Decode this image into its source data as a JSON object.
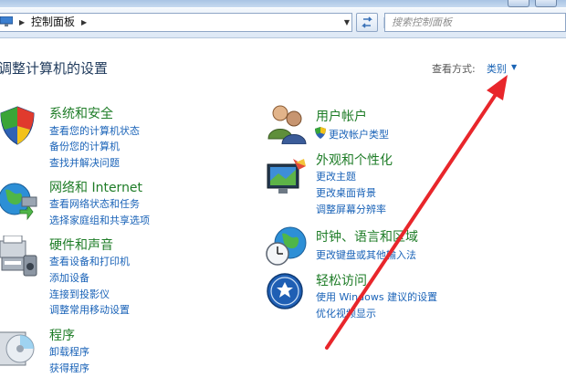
{
  "address": {
    "crumb": "控制面板",
    "search_placeholder": "搜索控制面板"
  },
  "header": {
    "title": "调整计算机的设置",
    "view_label": "查看方式:",
    "view_value": "类别"
  },
  "left_categories": [
    {
      "title": "系统和安全",
      "links": [
        "查看您的计算机状态",
        "备份您的计算机",
        "查找并解决问题"
      ]
    },
    {
      "title": "网络和 Internet",
      "links": [
        "查看网络状态和任务",
        "选择家庭组和共享选项"
      ]
    },
    {
      "title": "硬件和声音",
      "links": [
        "查看设备和打印机",
        "添加设备",
        "连接到投影仪",
        "调整常用移动设置"
      ]
    },
    {
      "title": "程序",
      "links": [
        "卸载程序",
        "获得程序"
      ]
    }
  ],
  "right_categories": [
    {
      "title": "用户帐户",
      "links": [
        "更改帐户类型"
      ]
    },
    {
      "title": "外观和个性化",
      "links": [
        "更改主题",
        "更改桌面背景",
        "调整屏幕分辨率"
      ]
    },
    {
      "title": "时钟、语言和区域",
      "links": [
        "更改键盘或其他输入法"
      ]
    },
    {
      "title": "轻松访问",
      "links": [
        "使用 Windows 建议的设置",
        "优化视频显示"
      ]
    }
  ],
  "annotation_color": "#e8262b"
}
